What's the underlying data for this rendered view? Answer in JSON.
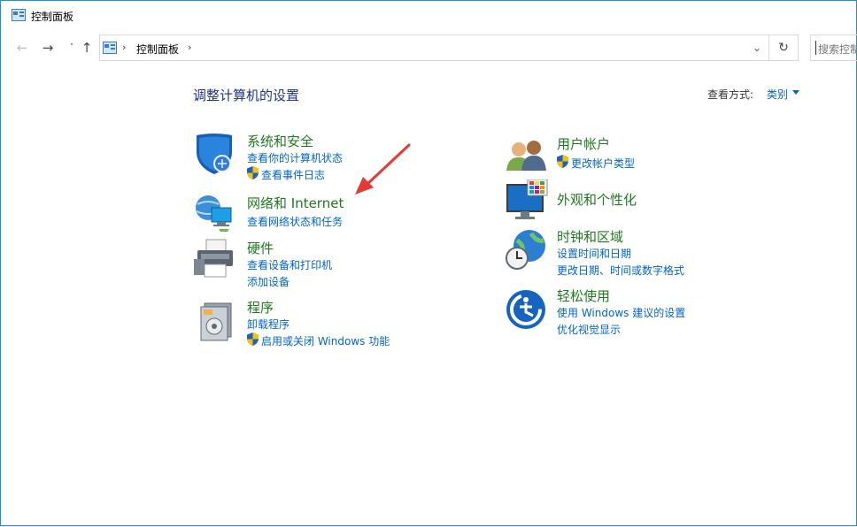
{
  "window": {
    "title": "控制面板"
  },
  "navigation": {
    "back_icon": "arrow-left-icon",
    "forward_icon": "arrow-right-icon",
    "recent_icon": "chevron-down-icon",
    "up_icon": "arrow-up-icon",
    "breadcrumb": [
      "控制面板"
    ],
    "search_placeholder": "搜索控制面板"
  },
  "main": {
    "heading": "调整计算机的设置",
    "view_by_label": "查看方式:",
    "view_by_value": "类别"
  },
  "categories": [
    {
      "title": "系统和安全",
      "links": [
        "查看你的计算机状态",
        "查看事件日志"
      ],
      "icon": "shield-icon"
    },
    {
      "title": "网络和 Internet",
      "links": [
        "查看网络状态和任务"
      ],
      "icon": "network-icon"
    },
    {
      "title": "硬件",
      "links": [
        "查看设备和打印机",
        "添加设备"
      ],
      "icon": "printer-icon"
    },
    {
      "title": "程序",
      "links": [
        "卸载程序",
        "启用或关闭 Windows 功能"
      ],
      "icon": "programs-icon"
    },
    {
      "title": "用户帐户",
      "links": [
        "更改帐户类型"
      ],
      "icon": "users-icon"
    },
    {
      "title": "外观和个性化",
      "links": [],
      "icon": "display-icon"
    },
    {
      "title": "时钟和区域",
      "links": [
        "设置时间和日期",
        "更改日期、时间或数字格式"
      ],
      "icon": "clock-globe-icon"
    },
    {
      "title": "轻松使用",
      "links": [
        "使用 Windows 建议的设置",
        "优化视觉显示"
      ],
      "icon": "accessibility-icon"
    }
  ],
  "colors": {
    "window_border": "#1c8fdc",
    "heading": "#1e3287",
    "category_title": "#1e7a1e",
    "link": "#0066cc",
    "annotation_arrow": "#e53935"
  }
}
